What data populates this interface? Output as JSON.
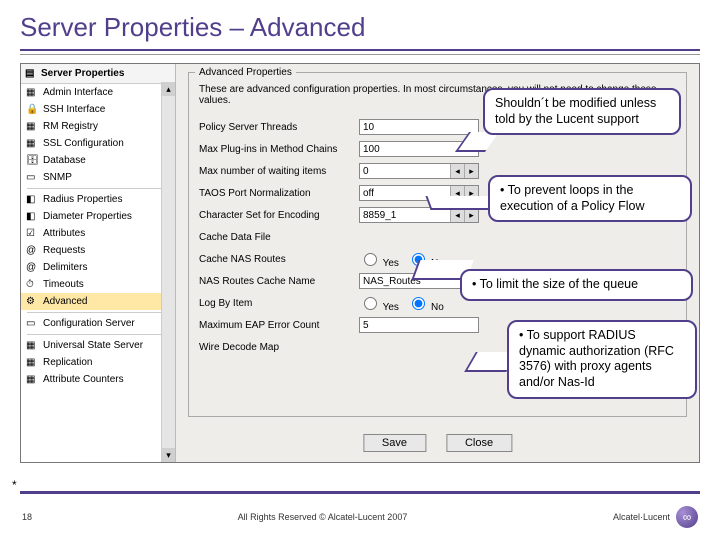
{
  "title": "Server Properties – Advanced",
  "sidebar": {
    "heading": "Server Properties",
    "items": [
      {
        "label": "Admin Interface",
        "ico": "▦"
      },
      {
        "label": "SSH Interface",
        "ico": "🔒"
      },
      {
        "label": "RM Registry",
        "ico": "▦"
      },
      {
        "label": "SSL Configuration",
        "ico": "▦"
      },
      {
        "label": "Database",
        "ico": "🗄"
      },
      {
        "label": "SNMP",
        "ico": "▭"
      },
      {
        "label": "Radius Properties",
        "ico": "◧"
      },
      {
        "label": "Diameter Properties",
        "ico": "◧"
      },
      {
        "label": "Attributes",
        "ico": "☑"
      },
      {
        "label": "Requests",
        "ico": "@"
      },
      {
        "label": "Delimiters",
        "ico": "@"
      },
      {
        "label": "Timeouts",
        "ico": "⏱"
      },
      {
        "label": "Advanced",
        "ico": "⚙"
      },
      {
        "label": "Configuration Server",
        "ico": "▭"
      },
      {
        "label": "Universal State Server",
        "ico": "▦"
      },
      {
        "label": "Replication",
        "ico": "▦"
      },
      {
        "label": "Attribute Counters",
        "ico": "▦"
      }
    ],
    "heading2": "Radius Properties",
    "selected": 12
  },
  "panel": {
    "legend": "Advanced Properties",
    "desc": "These are advanced configuration properties. In most circumstances, you will not need to change these values.",
    "rows": [
      {
        "label": "Policy Server Threads",
        "type": "text",
        "value": "10"
      },
      {
        "label": "Max Plug-ins in Method Chains",
        "type": "text",
        "value": "100"
      },
      {
        "label": "Max number of waiting items",
        "type": "scroll",
        "value": "0"
      },
      {
        "label": "TAOS Port Normalization",
        "type": "scroll",
        "value": "off"
      },
      {
        "label": "Character Set for Encoding",
        "type": "scroll",
        "value": "8859_1"
      },
      {
        "label": "Cache Data File",
        "type": "blank",
        "value": ""
      },
      {
        "label": "Cache NAS Routes",
        "type": "radio",
        "value": "No"
      },
      {
        "label": "NAS Routes Cache Name",
        "type": "text",
        "value": "NAS_Routes"
      },
      {
        "label": "Log By Item",
        "type": "radio",
        "value": "No"
      },
      {
        "label": "Maximum EAP Error Count",
        "type": "text",
        "value": "5"
      },
      {
        "label": "Wire Decode Map",
        "type": "blank",
        "value": ""
      }
    ],
    "yes": "Yes",
    "no": "No",
    "save": "Save",
    "close": "Close"
  },
  "callouts": {
    "c1": "Shouldn´t be modified unless told by the Lucent support",
    "c2": "• To prevent loops in the execution of a Policy Flow",
    "c3": "• To limit the size of the queue",
    "c4": "• To support RADIUS dynamic authorization (RFC 3576) with proxy agents and/or Nas-Id"
  },
  "footer": {
    "page": "18",
    "rights": "All Rights Reserved © Alcatel-Lucent 2007",
    "brand": "Alcatel·Lucent"
  }
}
